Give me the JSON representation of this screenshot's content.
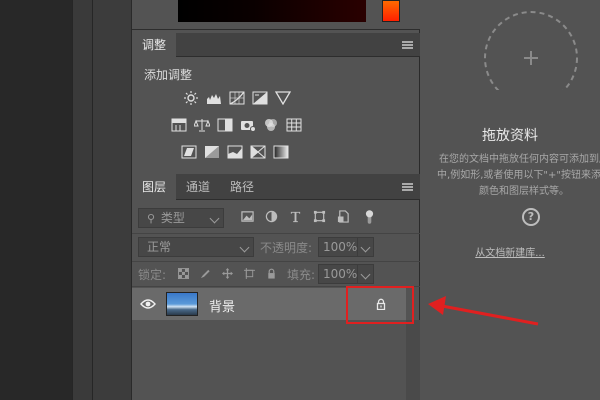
{
  "adjustments_panel": {
    "tab_label": "调整",
    "add_adjustment_label": "添加调整"
  },
  "layers_panel": {
    "tabs": [
      "图层",
      "通道",
      "路径"
    ],
    "filter_kind": "类型",
    "blend_mode": "正常",
    "opacity_label": "不透明度:",
    "opacity_value": "100%",
    "lock_label": "锁定:",
    "fill_label": "填充:",
    "fill_value": "100%",
    "layers": [
      {
        "name": "背景",
        "visible": true,
        "locked": true
      }
    ]
  },
  "libraries_panel": {
    "title": "拖放资料",
    "description": "在您的文档中拖放任何内容可添加到库中,例如形,或者使用以下\"+\"按钮来添加颜色和图层样式等。",
    "help_glyph": "?",
    "link_text": "从文档新建库..."
  },
  "colors": {
    "annotation": "#e02020",
    "panel_bg": "#535353"
  }
}
